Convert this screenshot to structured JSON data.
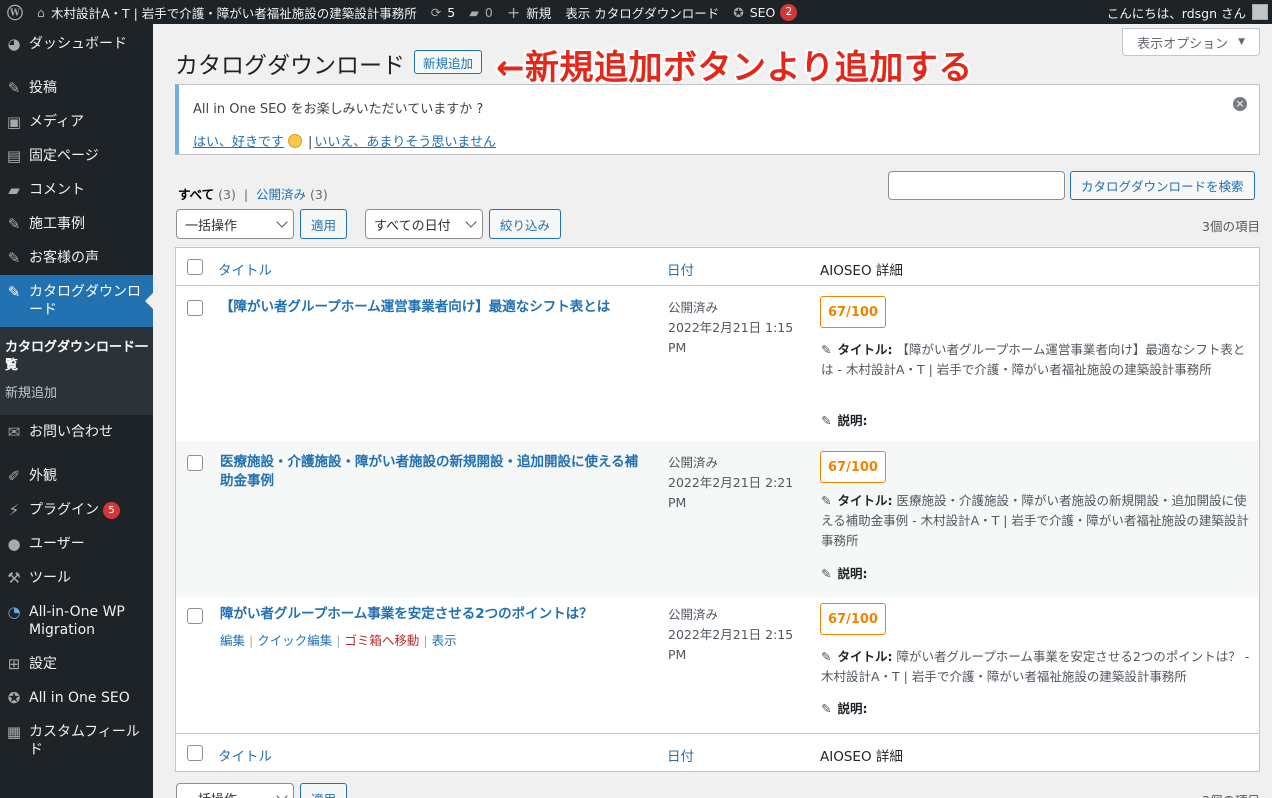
{
  "admin_bar": {
    "site_name": "木村設計A・T | 岩手で介護・障がい者福祉施設の建築設計事務所",
    "updates_count": "5",
    "comments_count": "0",
    "new_label": "新規",
    "view_label": "表示 カタログダウンロード",
    "seo_label": "SEO",
    "seo_badge": "2",
    "greeting": "こんにちは、rdsgn さん"
  },
  "sidebar": {
    "items": [
      {
        "label": "ダッシュボード",
        "icon": "dashboard-icon"
      },
      {
        "label": "投稿",
        "icon": "pin-icon"
      },
      {
        "label": "メディア",
        "icon": "media-icon"
      },
      {
        "label": "固定ページ",
        "icon": "page-icon"
      },
      {
        "label": "コメント",
        "icon": "comment-icon"
      },
      {
        "label": "施工事例",
        "icon": "pin-icon"
      },
      {
        "label": "お客様の声",
        "icon": "pin-icon"
      },
      {
        "label": "カタログダウンロード",
        "icon": "pin-icon"
      },
      {
        "label": "お問い合わせ",
        "icon": "mail-icon"
      },
      {
        "label": "外観",
        "icon": "brush-icon"
      },
      {
        "label": "プラグイン",
        "icon": "plugin-icon",
        "badge": "5"
      },
      {
        "label": "ユーザー",
        "icon": "user-icon"
      },
      {
        "label": "ツール",
        "icon": "wrench-icon"
      },
      {
        "label": "All-in-One WP Migration",
        "icon": "migration-icon"
      },
      {
        "label": "設定",
        "icon": "settings-icon"
      },
      {
        "label": "All in One SEO",
        "icon": "seo-icon"
      },
      {
        "label": "カスタムフィールド",
        "icon": "fields-icon"
      }
    ],
    "submenu": [
      {
        "label": "カタログダウンロード一覧"
      },
      {
        "label": "新規追加"
      }
    ]
  },
  "screen_options": "表示オプション",
  "page": {
    "title": "カタログダウンロード",
    "add_new": "新規追加",
    "annotation": "←新規追加ボタンより追加する"
  },
  "notice": {
    "message": "All in One SEO をお楽しみいただいていますか ?",
    "yes_link": "はい、好きです",
    "no_link": "いいえ、あまりそう思いません"
  },
  "filters": {
    "all_label": "すべて",
    "all_count": "(3)",
    "published_label": "公開済み",
    "published_count": "(3)",
    "search_button": "カタログダウンロードを検索",
    "bulk_action": "一括操作",
    "apply": "適用",
    "date_filter": "すべての日付",
    "filter_button": "絞り込み",
    "items_count": "3個の項目"
  },
  "table": {
    "columns": {
      "title": "タイトル",
      "date": "日付",
      "aioseo": "AIOSEO 詳細"
    },
    "seo_title_label": "タイトル:",
    "seo_desc_label": "説明:",
    "rows": [
      {
        "title": "【障がい者グループホーム運営事業者向け】最適なシフト表とは",
        "status": "公開済み",
        "date": "2022年2月21日 1:15 PM",
        "score": "67/100",
        "seo_title": "【障がい者グループホーム運営事業者向け】最適なシフト表とは - 木村設計A・T | 岩手で介護・障がい者福祉施設の建築設計事務所"
      },
      {
        "title": "医療施設・介護施設・障がい者施設の新規開設・追加開設に使える補助金事例",
        "status": "公開済み",
        "date": "2022年2月21日 2:21 PM",
        "score": "67/100",
        "seo_title": "医療施設・介護施設・障がい者施設の新規開設・追加開設に使える補助金事例 - 木村設計A・T | 岩手で介護・障がい者福祉施設の建築設計事務所"
      },
      {
        "title": "障がい者グループホーム事業を安定させる2つのポイントは？",
        "status": "公開済み",
        "date": "2022年2月21日 2:15 PM",
        "score": "67/100",
        "seo_title": "障がい者グループホーム事業を安定させる2つのポイントは？ - 木村設計A・T | 岩手で介護・障がい者福祉施設の建築設計事務所",
        "actions": [
          "編集",
          "クイック編集",
          "ゴミ箱へ移動",
          "表示"
        ]
      }
    ]
  }
}
